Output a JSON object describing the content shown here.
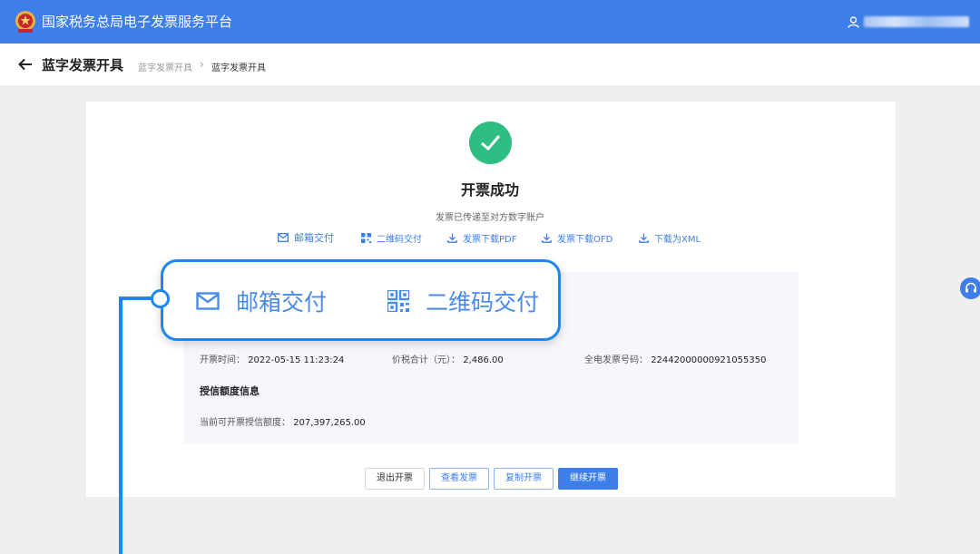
{
  "header": {
    "platform_title": "国家税务总局电子发票服务平台",
    "logo_icon": "tax-emblem-icon",
    "user_icon": "user-icon",
    "brand_color": "#3d7ee8"
  },
  "subheader": {
    "page_title": "蓝字发票开具",
    "breadcrumb": [
      "蓝字发票开具",
      "蓝字发票开具"
    ],
    "breadcrumb_separator": "›"
  },
  "result": {
    "status_icon": "check-circle-icon",
    "title": "开票成功",
    "description": "发票已传递至对方数字账户",
    "success_color": "#2ebd82"
  },
  "actions": [
    {
      "label": "邮箱交付",
      "icon": "mail-icon"
    },
    {
      "label": "二维码交付",
      "icon": "qrcode-icon"
    },
    {
      "label": "发票下载PDF",
      "icon": "download-icon"
    },
    {
      "label": "发票下载OFD",
      "icon": "download-icon"
    },
    {
      "label": "下载为XML",
      "icon": "download-icon"
    }
  ],
  "invoice_info": {
    "issue_time_label": "开票时间：",
    "issue_time": "2022-05-15 11:23:24",
    "total_label": "价税合计（元）：",
    "total": "2,486.00",
    "number_label": "全电发票号码：",
    "number": "22442000000921055350"
  },
  "credit_info": {
    "title": "授信额度信息",
    "available_label": "当前可开票授信额度：",
    "available": "207,397,265.00"
  },
  "buttons": {
    "exit": "退出开票",
    "view": "查看发票",
    "copy": "复制开票",
    "continue": "继续开票"
  },
  "callout": {
    "items": [
      {
        "label": "邮箱交付",
        "icon": "mail-icon"
      },
      {
        "label": "二维码交付",
        "icon": "qrcode-icon"
      }
    ],
    "color": "#1f86ef"
  },
  "float_button": {
    "icon": "headset-icon"
  }
}
